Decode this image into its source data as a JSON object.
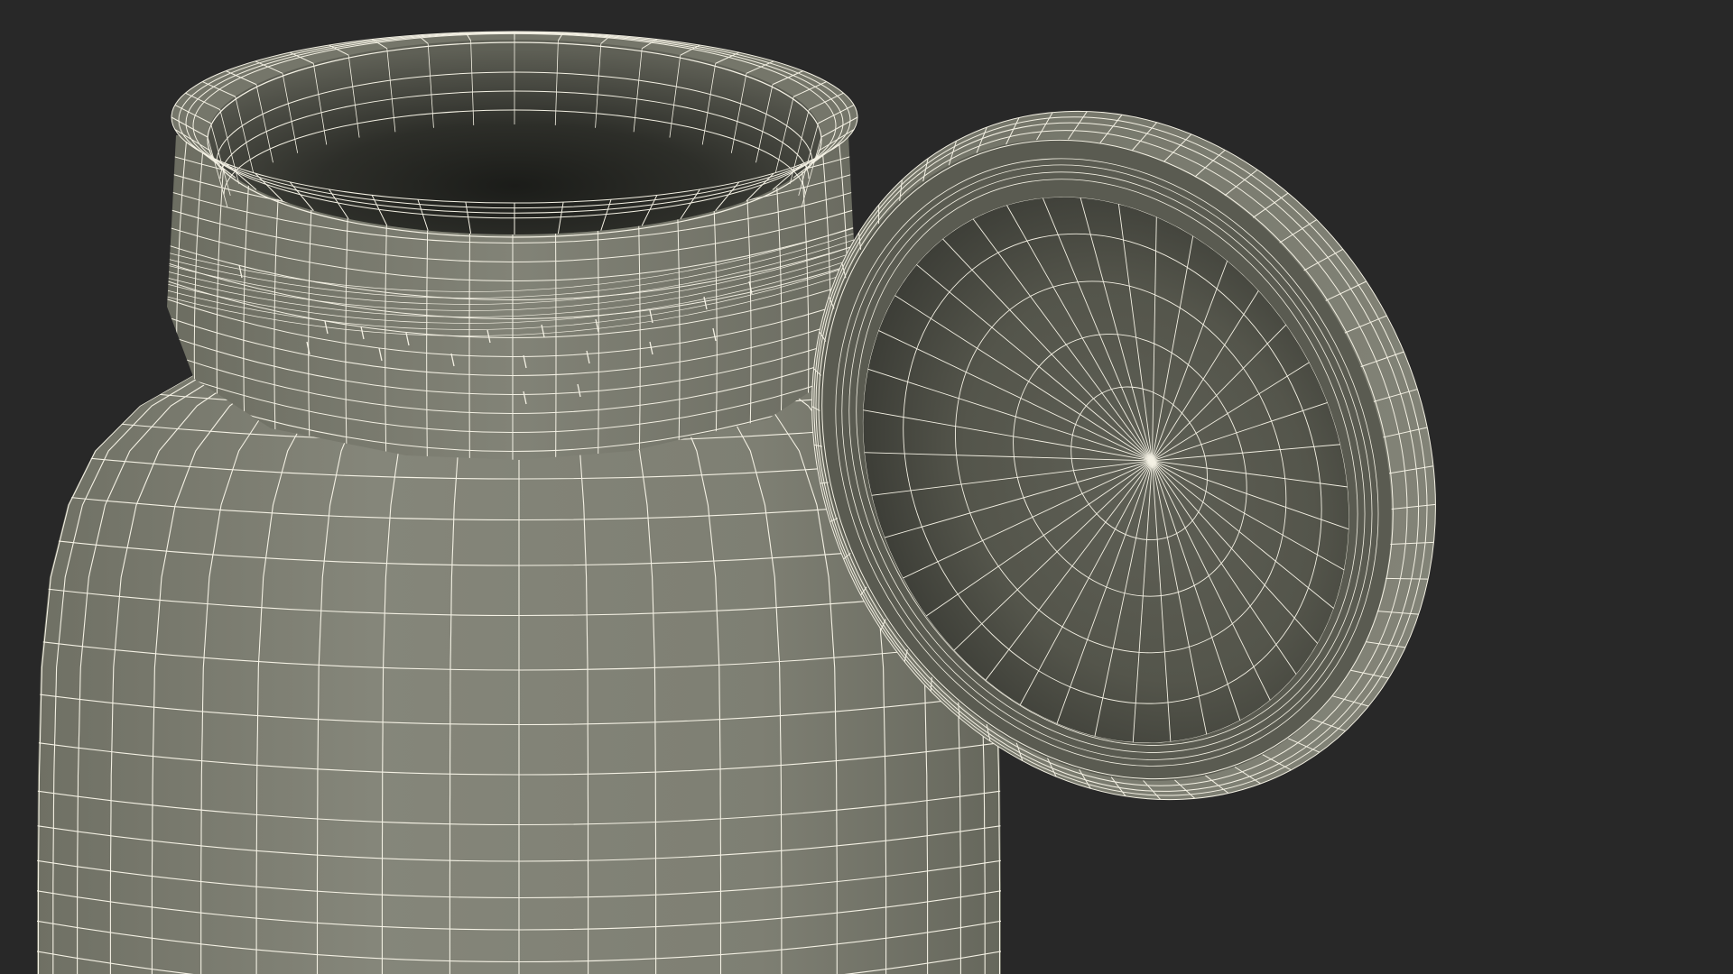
{
  "scene": {
    "background_color": "#282828",
    "mesh_color": "#7d7e71",
    "mesh_shadow_color": "#4a4b43",
    "mesh_dark_color": "#3a3b35",
    "wire_color": "#f4f1e4",
    "objects": [
      {
        "name": "jar",
        "description_icon": "jar-wireframe-icon"
      },
      {
        "name": "lid",
        "description_icon": "lid-wireframe-icon"
      }
    ]
  }
}
